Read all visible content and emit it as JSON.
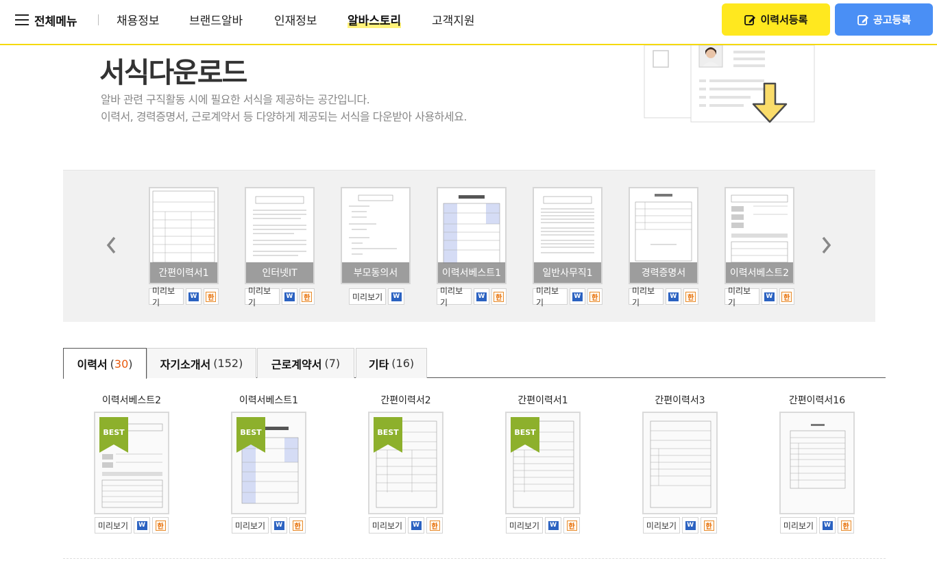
{
  "header": {
    "menu_label": "전체메뉴",
    "nav": [
      "채용정보",
      "브랜드알바",
      "인재정보",
      "알바스토리",
      "고객지원"
    ],
    "active_nav": "알바스토리",
    "resume_button": "이력서등록",
    "post_button": "공고등록"
  },
  "hero": {
    "title": "서식다운로드",
    "desc1": "알바 관련 구직활동 시에 필요한 서식을 제공하는 공간입니다.",
    "desc2": "이력서, 경력증명서, 근로계약서 등 다양하게 제공되는 서식을 다운받아 사용하세요."
  },
  "carousel": {
    "items": [
      {
        "label": "간편이력서1",
        "preview": "미리보기",
        "word": "W",
        "hwp": true
      },
      {
        "label": "인터넷IT",
        "preview": "미리보기",
        "word": "W",
        "hwp": true
      },
      {
        "label": "부모동의서",
        "preview": "미리보기",
        "word": "W",
        "hwp": false
      },
      {
        "label": "이력서베스트1",
        "preview": "미리보기",
        "word": "W",
        "hwp": true
      },
      {
        "label": "일반사무직1",
        "preview": "미리보기",
        "word": "W",
        "hwp": true
      },
      {
        "label": "경력증명서",
        "preview": "미리보기",
        "word": "W",
        "hwp": true
      },
      {
        "label": "이력서베스트2",
        "preview": "미리보기",
        "word": "W",
        "hwp": true
      }
    ]
  },
  "tabs": [
    {
      "name": "이력서",
      "count": "30"
    },
    {
      "name": "자기소개서",
      "count": "152"
    },
    {
      "name": "근로계약서",
      "count": "7"
    },
    {
      "name": "기타",
      "count": "16"
    }
  ],
  "documents": [
    {
      "title": "이력서베스트2",
      "best": true,
      "preview": "미리보기",
      "word": "W"
    },
    {
      "title": "이력서베스트1",
      "best": true,
      "preview": "미리보기",
      "word": "W"
    },
    {
      "title": "간편이력서2",
      "best": true,
      "preview": "미리보기",
      "word": "W"
    },
    {
      "title": "간편이력서1",
      "best": true,
      "preview": "미리보기",
      "word": "W"
    },
    {
      "title": "간편이력서3",
      "best": false,
      "preview": "미리보기",
      "word": "W"
    },
    {
      "title": "간편이력서16",
      "best": false,
      "preview": "미리보기",
      "word": "W"
    }
  ],
  "best_label": "BEST",
  "colors": {
    "accent_yellow": "#ffe81f",
    "accent_blue": "#4a8ff5",
    "count_orange": "#e8590c",
    "best_green": "#8db02c"
  }
}
